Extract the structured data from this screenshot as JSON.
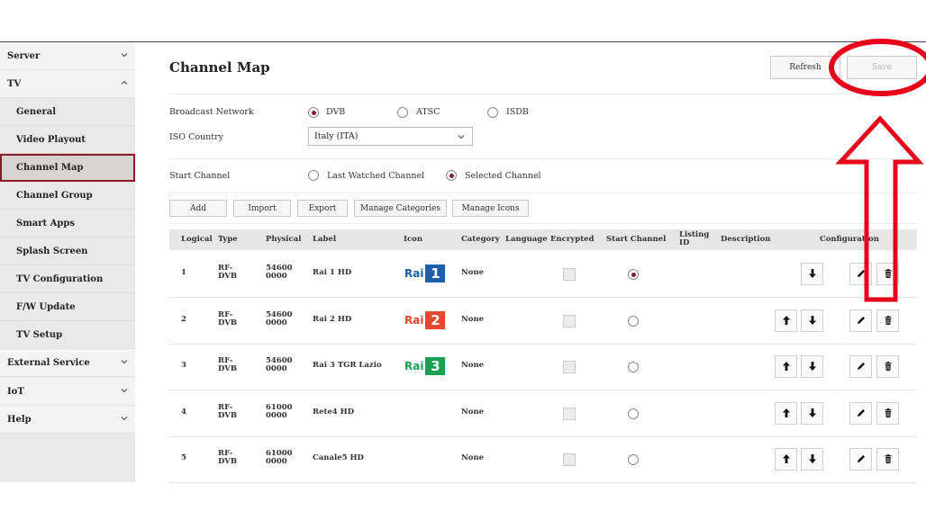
{
  "sidebar": {
    "items": [
      {
        "label": "Server",
        "kind": "top",
        "chevron": "down"
      },
      {
        "label": "TV",
        "kind": "top",
        "chevron": "up"
      },
      {
        "label": "General",
        "kind": "sub"
      },
      {
        "label": "Video Playout",
        "kind": "sub"
      },
      {
        "label": "Channel Map",
        "kind": "sub",
        "active": true
      },
      {
        "label": "Channel Group",
        "kind": "sub"
      },
      {
        "label": "Smart Apps",
        "kind": "sub"
      },
      {
        "label": "Splash Screen",
        "kind": "sub"
      },
      {
        "label": "TV Configuration",
        "kind": "sub"
      },
      {
        "label": "F/W Update",
        "kind": "sub"
      },
      {
        "label": "TV Setup",
        "kind": "sub"
      },
      {
        "label": "External Service",
        "kind": "top",
        "chevron": "down"
      },
      {
        "label": "IoT",
        "kind": "top",
        "chevron": "down"
      },
      {
        "label": "Help",
        "kind": "top",
        "chevron": "down"
      }
    ]
  },
  "page": {
    "title": "Channel Map",
    "refresh_label": "Refresh",
    "save_label": "Save",
    "broadcast_label": "Broadcast Network",
    "broadcast_options": [
      "DVB",
      "ATSC",
      "ISDB"
    ],
    "broadcast_selected": "DVB",
    "country_label": "ISO Country",
    "country_value": "Italy (ITA)",
    "start_label": "Start Channel",
    "start_options": [
      "Last Watched Channel",
      "Selected Channel"
    ],
    "start_selected": "Selected Channel",
    "toolbar": [
      "Add",
      "Import",
      "Export",
      "Manage Categories",
      "Manage Icons"
    ]
  },
  "table": {
    "headers": {
      "logical": "Logical",
      "type": "Type",
      "physical": "Physical",
      "label": "Label",
      "icon": "Icon",
      "category": "Category",
      "language": "Language",
      "encrypted": "Encrypted",
      "start": "Start Channel",
      "listing": "Listing ID",
      "description": "Description",
      "configuration": "Configuration"
    },
    "rows": [
      {
        "logical": "1",
        "type": "RF-DVB",
        "physical": "546000000",
        "label": "Rai 1 HD",
        "icon": {
          "text": "Rai",
          "num": "1",
          "color": "#1f5fa8"
        },
        "category": "None",
        "start": true,
        "up": false
      },
      {
        "logical": "2",
        "type": "RF-DVB",
        "physical": "546000000",
        "label": "Rai 2 HD",
        "icon": {
          "text": "Rai",
          "num": "2",
          "color": "#e4482e"
        },
        "category": "None",
        "start": false,
        "up": true
      },
      {
        "logical": "3",
        "type": "RF-DVB",
        "physical": "546000000",
        "label": "Rai 3 TGR Lazio",
        "icon": {
          "text": "Rai",
          "num": "3",
          "color": "#1ba053"
        },
        "category": "None",
        "start": false,
        "up": true
      },
      {
        "logical": "4",
        "type": "RF-DVB",
        "physical": "610000000",
        "label": "Rete4 HD",
        "icon": null,
        "category": "None",
        "start": false,
        "up": true
      },
      {
        "logical": "5",
        "type": "RF-DVB",
        "physical": "610000000",
        "label": "Canale5 HD",
        "icon": null,
        "category": "None",
        "start": false,
        "up": true
      }
    ]
  },
  "colors": {
    "accent": "#8b1a2b",
    "annotation": "#e8001b"
  }
}
